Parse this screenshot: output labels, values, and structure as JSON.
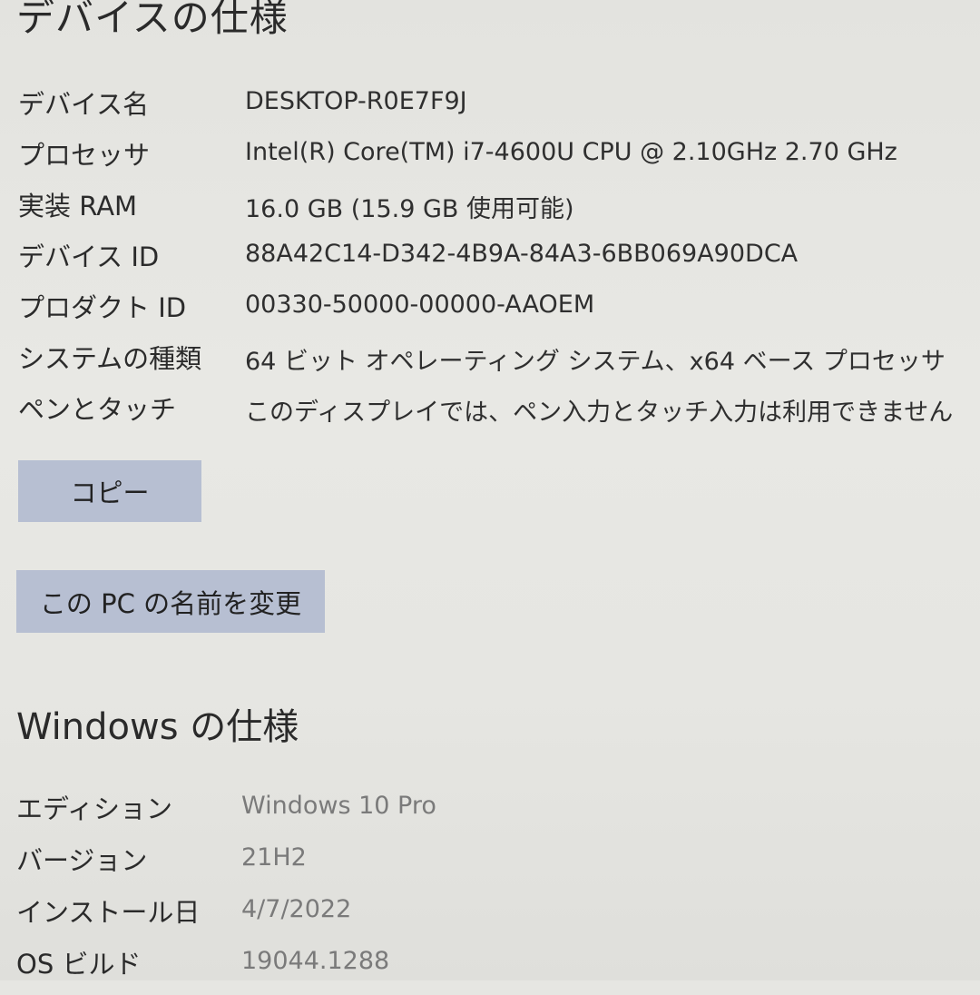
{
  "device_spec": {
    "title": "デバイスの仕様",
    "rows": [
      {
        "label": "デバイス名",
        "value": "DESKTOP-R0E7F9J"
      },
      {
        "label": "プロセッサ",
        "value": "Intel(R) Core(TM) i7-4600U CPU @ 2.10GHz   2.70 GHz"
      },
      {
        "label": "実装 RAM",
        "value": "16.0 GB (15.9 GB 使用可能)"
      },
      {
        "label": "デバイス ID",
        "value": "88A42C14-D342-4B9A-84A3-6BB069A90DCA"
      },
      {
        "label": "プロダクト ID",
        "value": "00330-50000-00000-AAOEM"
      },
      {
        "label": "システムの種類",
        "value": "64 ビット オペレーティング システム、x64 ベース プロセッサ"
      },
      {
        "label": "ペンとタッチ",
        "value": "このディスプレイでは、ペン入力とタッチ入力は利用できません"
      }
    ],
    "copy_button": "コピー",
    "rename_button": "この PC の名前を変更"
  },
  "windows_spec": {
    "title": "Windows の仕様",
    "rows": [
      {
        "label": "エディション",
        "value": "Windows 10 Pro"
      },
      {
        "label": "バージョン",
        "value": "21H2"
      },
      {
        "label": "インストール日",
        "value": "4/7/2022"
      },
      {
        "label": "OS ビルド",
        "value": "19044.1288"
      }
    ]
  }
}
